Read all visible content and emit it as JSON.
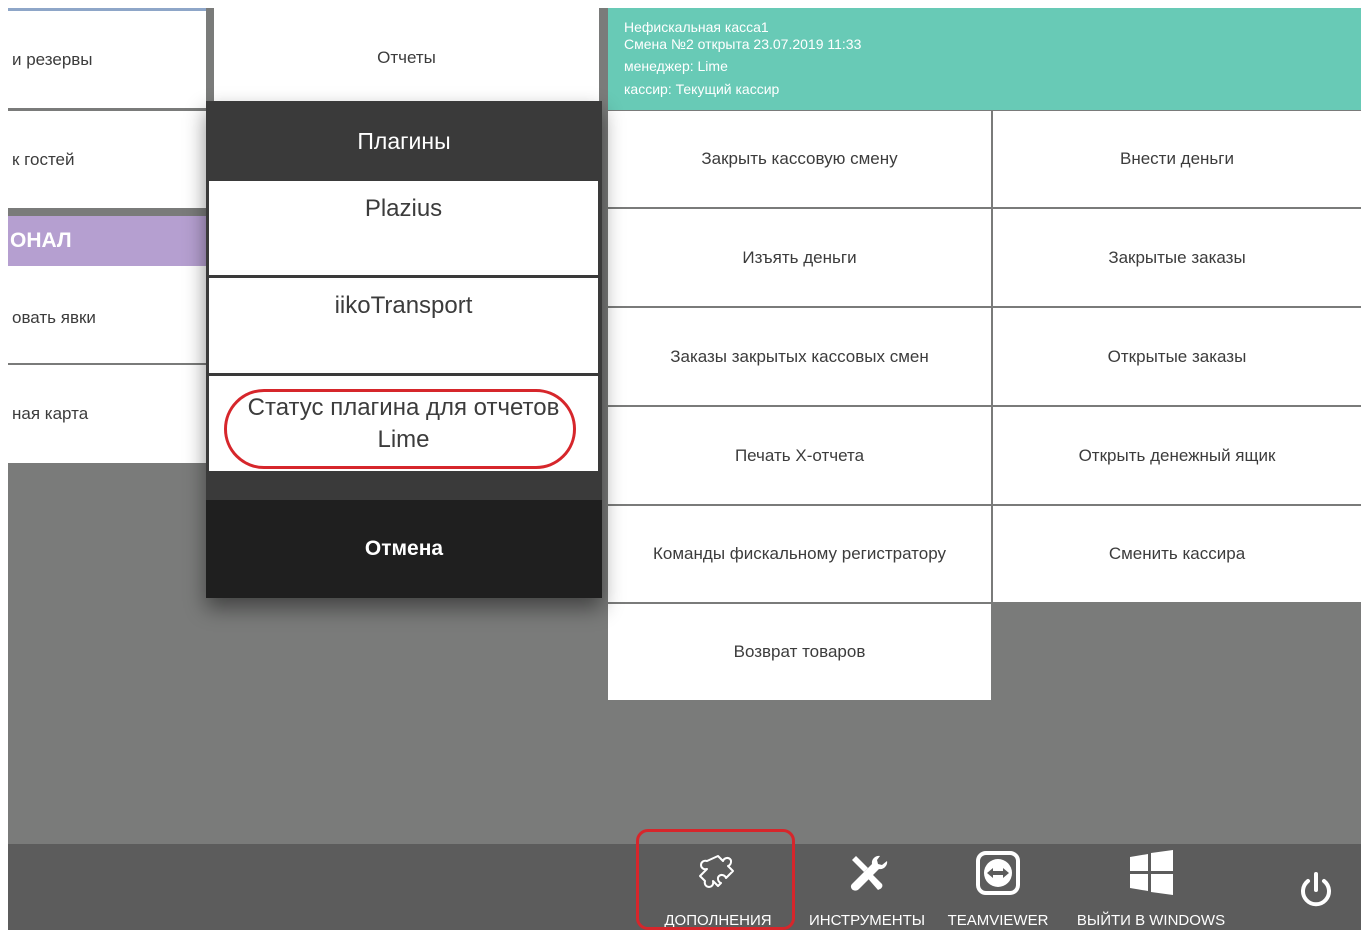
{
  "left_menu": {
    "items": [
      {
        "label": "и резервы"
      },
      {
        "label": "к гостей"
      },
      {
        "label": "овать явки"
      },
      {
        "label": "ная карта"
      }
    ],
    "section_header": "ОНАЛ"
  },
  "reports_tile": {
    "label": "Отчеты"
  },
  "session_info": {
    "register": "Нефискальная касса1",
    "shift": "Смена №2 открыта 23.07.2019 11:33",
    "manager": "менеджер: Lime",
    "cashier": "кассир: Текущий кассир"
  },
  "actions": {
    "close_shift": "Закрыть кассовую смену",
    "deposit": "Внести деньги",
    "withdraw": "Изъять деньги",
    "closed_orders": "Закрытые заказы",
    "closed_shift_orders": "Заказы закрытых кассовых смен",
    "open_orders": "Открытые заказы",
    "print_x_report": "Печать Х-отчета",
    "open_cash_drawer": "Открыть денежный ящик",
    "fiscal_commands": "Команды фискальному регистратору",
    "change_cashier": "Сменить кассира",
    "return_goods": "Возврат товаров"
  },
  "plugins_popup": {
    "title": "Плагины",
    "items": [
      {
        "label": "Plazius"
      },
      {
        "label": "iikoTransport"
      },
      {
        "label_line1": "Статус плагина для отчетов",
        "label_line2": "Lime"
      }
    ],
    "cancel": "Отмена"
  },
  "toolbar": {
    "addons": {
      "label": "ДОПОЛНЕНИЯ",
      "icon": "puzzle-icon"
    },
    "tools": {
      "label": "ИНСТРУМЕНТЫ",
      "icon": "tools-icon"
    },
    "teamviewer": {
      "label": "TEAMVIEWER",
      "icon": "teamviewer-icon"
    },
    "exit_windows": {
      "label": "ВЫЙТИ В WINDOWS",
      "icon": "windows-icon"
    },
    "power": {
      "icon": "power-icon"
    }
  },
  "colors": {
    "background": "#7a7b7a",
    "info_header": "#68cab6",
    "section_header": "#b59fd0",
    "popup": "#3a3a3a",
    "cancel": "#1f1f1f",
    "toolbar": "#5c5c5c",
    "highlight": "#d6262b"
  }
}
